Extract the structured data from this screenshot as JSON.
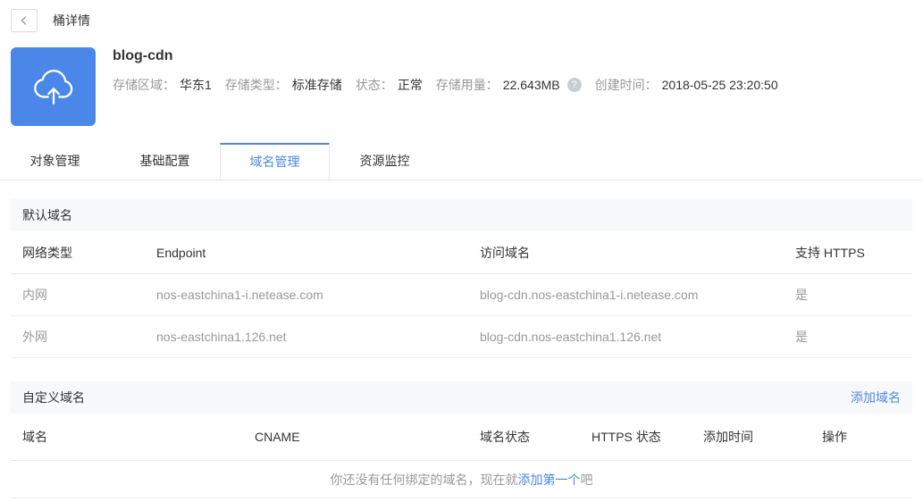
{
  "topbar": {
    "title": "桶详情"
  },
  "bucket": {
    "name": "blog-cdn",
    "help_glyph": "?",
    "details": [
      {
        "label": "存储区域：",
        "value": "华东1"
      },
      {
        "label": "存储类型：",
        "value": "标准存储"
      },
      {
        "label": "状态：",
        "value": "正常"
      },
      {
        "label": "存储用量：",
        "value": "22.643MB"
      },
      {
        "label": "创建时间：",
        "value": "2018-05-25 23:20:50"
      }
    ]
  },
  "tabs": [
    {
      "label": "对象管理",
      "active": false
    },
    {
      "label": "基础配置",
      "active": false
    },
    {
      "label": "域名管理",
      "active": true
    },
    {
      "label": "资源监控",
      "active": false
    }
  ],
  "default_domain": {
    "section_title": "默认域名",
    "columns": [
      "网络类型",
      "Endpoint",
      "访问域名",
      "支持 HTTPS"
    ],
    "rows": [
      [
        "内网",
        "nos-eastchina1-i.netease.com",
        "blog-cdn.nos-eastchina1-i.netease.com",
        "是"
      ],
      [
        "外网",
        "nos-eastchina1.126.net",
        "blog-cdn.nos-eastchina1.126.net",
        "是"
      ]
    ]
  },
  "custom_domain": {
    "section_title": "自定义域名",
    "add_button": "添加域名",
    "columns": [
      "域名",
      "CNAME",
      "域名状态",
      "HTTPS 状态",
      "添加时间",
      "操作"
    ],
    "empty_prefix": "你还没有任何绑定的域名，现在就",
    "empty_link": "添加第一个",
    "empty_suffix": "吧"
  },
  "colors": {
    "accent": "#4a87e8",
    "icon_background": "#4a87e8",
    "section_background": "#f7f8fa",
    "muted_text": "#999999",
    "text": "#333333",
    "border": "#e6e6e6"
  }
}
